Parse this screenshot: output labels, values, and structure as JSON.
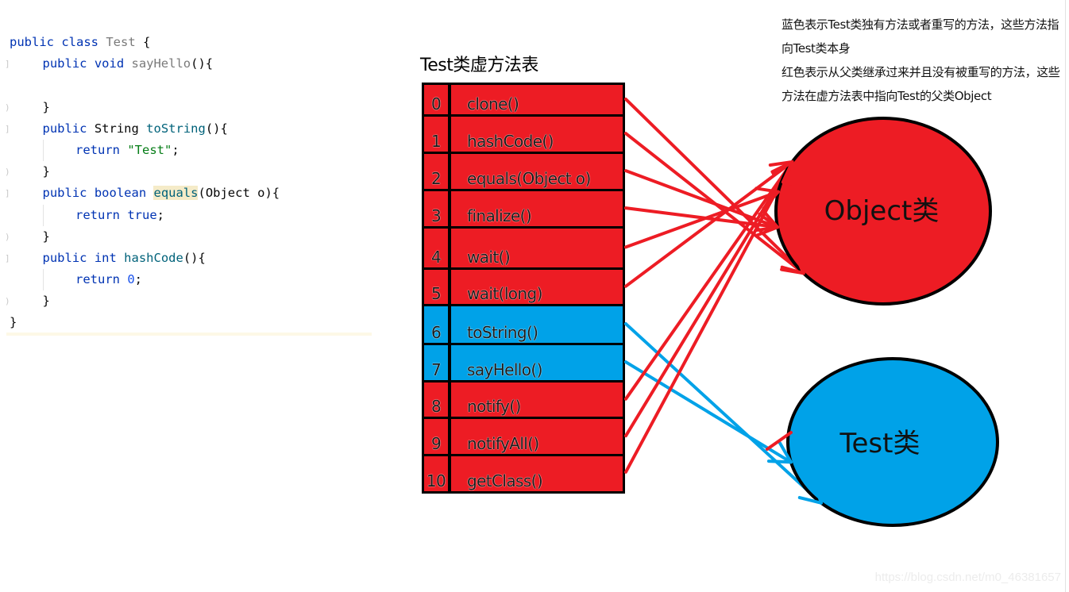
{
  "code": {
    "lines": [
      {
        "gutter": "",
        "indent": 0,
        "guide": false,
        "tokens": [
          {
            "t": "public class ",
            "c": "kw"
          },
          {
            "t": "Test",
            "c": "unused"
          },
          {
            "t": " {",
            "c": ""
          }
        ]
      },
      {
        "gutter": "]",
        "indent": 1,
        "guide": false,
        "tokens": [
          {
            "t": "public void ",
            "c": "kw"
          },
          {
            "t": "sayHello",
            "c": "unused"
          },
          {
            "t": "(){",
            "c": ""
          }
        ]
      },
      {
        "gutter": "",
        "indent": 1,
        "guide": false,
        "tokens": []
      },
      {
        "gutter": ")",
        "indent": 1,
        "guide": false,
        "tokens": [
          {
            "t": "}",
            "c": ""
          }
        ]
      },
      {
        "gutter": "]",
        "indent": 1,
        "guide": false,
        "tokens": [
          {
            "t": "public ",
            "c": "kw"
          },
          {
            "t": "String ",
            "c": ""
          },
          {
            "t": "toString",
            "c": "method"
          },
          {
            "t": "(){",
            "c": ""
          }
        ]
      },
      {
        "gutter": "",
        "indent": 2,
        "guide": true,
        "tokens": [
          {
            "t": "return ",
            "c": "kw"
          },
          {
            "t": "\"Test\"",
            "c": "str"
          },
          {
            "t": ";",
            "c": ""
          }
        ]
      },
      {
        "gutter": ")",
        "indent": 1,
        "guide": false,
        "tokens": [
          {
            "t": "}",
            "c": ""
          }
        ]
      },
      {
        "gutter": "]",
        "indent": 1,
        "guide": false,
        "tokens": [
          {
            "t": "public boolean ",
            "c": "kw"
          },
          {
            "t": "equals",
            "c": "method hl"
          },
          {
            "t": "(Object o){",
            "c": ""
          }
        ]
      },
      {
        "gutter": "",
        "indent": 2,
        "guide": true,
        "tokens": [
          {
            "t": "return true",
            "c": "kw"
          },
          {
            "t": ";",
            "c": ""
          }
        ]
      },
      {
        "gutter": ")",
        "indent": 1,
        "guide": false,
        "tokens": [
          {
            "t": "}",
            "c": ""
          }
        ]
      },
      {
        "gutter": "]",
        "indent": 1,
        "guide": false,
        "tokens": [
          {
            "t": "public int ",
            "c": "kw"
          },
          {
            "t": "hashCode",
            "c": "method"
          },
          {
            "t": "(){",
            "c": ""
          }
        ]
      },
      {
        "gutter": "",
        "indent": 2,
        "guide": true,
        "tokens": [
          {
            "t": "return ",
            "c": "kw"
          },
          {
            "t": "0",
            "c": "num"
          },
          {
            "t": ";",
            "c": ""
          }
        ]
      },
      {
        "gutter": ")",
        "indent": 1,
        "guide": false,
        "tokens": [
          {
            "t": "}",
            "c": ""
          }
        ]
      },
      {
        "gutter": "",
        "indent": 0,
        "guide": false,
        "tokens": [
          {
            "t": "}",
            "c": ""
          }
        ]
      }
    ]
  },
  "table": {
    "title": "Test类虚方法表",
    "rows": [
      {
        "index": "0",
        "method": "clone()",
        "color": "red",
        "target": "object"
      },
      {
        "index": "1",
        "method": "hashCode()",
        "color": "red",
        "target": "object"
      },
      {
        "index": "2",
        "method": "equals(Object o)",
        "color": "red",
        "target": "object"
      },
      {
        "index": "3",
        "method": "finalize()",
        "color": "red",
        "target": "object"
      },
      {
        "index": "4",
        "method": "wait()",
        "color": "red",
        "target": "object"
      },
      {
        "index": "5",
        "method": "wait(long)",
        "color": "red",
        "target": "object"
      },
      {
        "index": "6",
        "method": "toString()",
        "color": "blue",
        "target": "test"
      },
      {
        "index": "7",
        "method": "sayHello()",
        "color": "blue",
        "target": "test"
      },
      {
        "index": "8",
        "method": "notify()",
        "color": "red",
        "target": "object"
      },
      {
        "index": "9",
        "method": "notifyAll()",
        "color": "red",
        "target": "object"
      },
      {
        "index": "10",
        "method": "getClass()",
        "color": "red",
        "target": "object"
      }
    ]
  },
  "legend": {
    "blue_text": "蓝色表示Test类独有方法或者重写的方法，这些方法指向Test类本身",
    "red_text": "红色表示从父类继承过来并且没有被重写的方法，这些方法在虚方法表中指向Test的父类Object"
  },
  "nodes": {
    "object_label": "Object类",
    "test_label": "Test类"
  },
  "colors": {
    "red": "#ed1c24",
    "blue": "#00a2e8",
    "border": "#000000"
  },
  "watermark": "https://blog.csdn.net/m0_46381657"
}
